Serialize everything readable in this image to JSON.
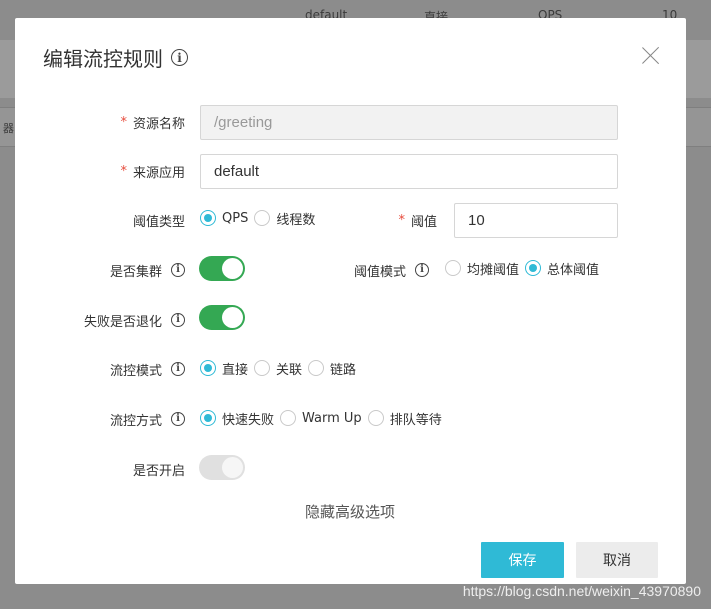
{
  "background": {
    "top_texts": [
      "default",
      "直接",
      "QPS",
      "10"
    ],
    "side_text": "器"
  },
  "modal": {
    "title": "编辑流控规则",
    "close_label": "×",
    "fields": {
      "resource_name": {
        "label": "资源名称",
        "value": "/greeting"
      },
      "source_app": {
        "label": "来源应用",
        "value": "default"
      },
      "threshold_type": {
        "label": "阈值类型",
        "options": [
          "QPS",
          "线程数"
        ],
        "selected": "QPS"
      },
      "threshold": {
        "label": "阈值",
        "value": "10"
      },
      "cluster": {
        "label": "是否集群",
        "on": true
      },
      "threshold_mode": {
        "label": "阈值模式",
        "options": [
          "均摊阈值",
          "总体阈值"
        ],
        "selected": "总体阈值"
      },
      "fallback": {
        "label": "失败是否退化",
        "on": true
      },
      "flow_mode": {
        "label": "流控模式",
        "options": [
          "直接",
          "关联",
          "链路"
        ],
        "selected": "直接"
      },
      "flow_effect": {
        "label": "流控方式",
        "options": [
          "快速失败",
          "Warm Up",
          "排队等待"
        ],
        "selected": "快速失败"
      },
      "enabled": {
        "label": "是否开启",
        "on": false,
        "disabled": true
      }
    },
    "advanced_link": "隐藏高级选项",
    "save_label": "保存",
    "cancel_label": "取消"
  },
  "watermark": "https://blog.csdn.net/weixin_43970890",
  "colors": {
    "accent": "#2fbad6",
    "switch_on": "#34a853",
    "required": "#e64a3b"
  },
  "icons": {
    "info": "info-circle-icon",
    "close": "close-icon"
  }
}
